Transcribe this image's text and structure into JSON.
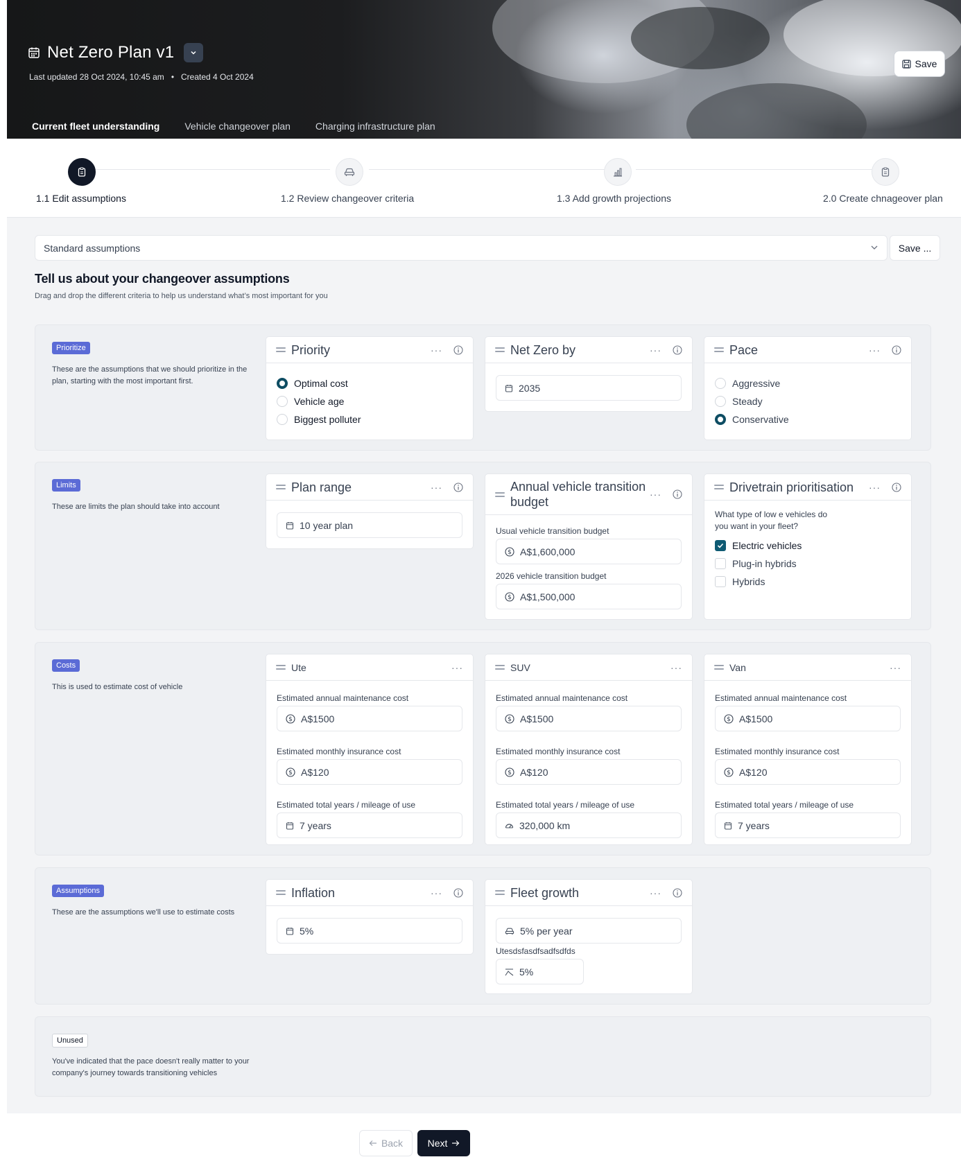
{
  "header": {
    "title": "Net Zero Plan v1",
    "last_updated": "Last updated 28 Oct 2024, 10:45 am",
    "separator": "•",
    "created": "Created 4 Oct 2024",
    "save_label": "Save"
  },
  "tabs": [
    {
      "label": "Current fleet understanding",
      "active": true
    },
    {
      "label": "Vehicle changeover plan",
      "active": false
    },
    {
      "label": "Charging infrastructure plan",
      "active": false
    }
  ],
  "steps": [
    {
      "label": "1.1 Edit assumptions",
      "icon": "clipboard-icon",
      "active": true
    },
    {
      "label": "1.2 Review changeover criteria",
      "icon": "car-icon",
      "active": false
    },
    {
      "label": "1.3 Add growth projections",
      "icon": "bar-chart-icon",
      "active": false
    },
    {
      "label": "2.0 Create chnageover plan",
      "icon": "clipboard-icon",
      "active": false
    }
  ],
  "assumption_set": {
    "selected": "Standard assumptions",
    "save_label": "Save ..."
  },
  "intro": {
    "title": "Tell us about your changeover assumptions",
    "subtitle": "Drag and drop the different criteria to help us understand what’s most important for you"
  },
  "groups": {
    "prioritize": {
      "badge": "Prioritize",
      "description": "These are the assumptions that we should prioritize in the plan, starting with the most important first.",
      "priority": {
        "title": "Priority",
        "options": [
          "Optimal cost",
          "Vehicle age",
          "Biggest polluter"
        ],
        "selected": "Optimal cost"
      },
      "net_zero": {
        "title": "Net Zero by",
        "value": "2035"
      },
      "pace": {
        "title": "Pace",
        "options": [
          "Aggressive",
          "Steady",
          "Conservative"
        ],
        "selected": "Conservative"
      }
    },
    "limits": {
      "badge": "Limits",
      "description": "These are limits the plan should take into account",
      "plan_range": {
        "title": "Plan range",
        "value": "10 year plan"
      },
      "budget": {
        "title": "Annual vehicle transition budget",
        "usual_label": "Usual vehicle transition budget",
        "usual_value": "A$1,600,000",
        "y2026_label": "2026 vehicle transition budget",
        "y2026_value": "A$1,500,000"
      },
      "drivetrain": {
        "title": "Drivetrain prioritisation",
        "question": "What type of low e vehicles do you want in your fleet?",
        "options": [
          {
            "label": "Electric vehicles",
            "checked": true
          },
          {
            "label": "Plug-in hybrids",
            "checked": false
          },
          {
            "label": "Hybrids",
            "checked": false
          }
        ]
      }
    },
    "costs": {
      "badge": "Costs",
      "description": "This is used to estimate cost of vehicle",
      "maintenance_label": "Estimated annual maintenance cost",
      "insurance_label": "Estimated monthly insurance cost",
      "usage_label": "Estimated total years / mileage of use",
      "vehicles": [
        {
          "title": "Ute",
          "maintenance": "A$1500",
          "insurance": "A$120",
          "usage": "7 years",
          "usage_icon": "calendar-icon"
        },
        {
          "title": "SUV",
          "maintenance": "A$1500",
          "insurance": "A$120",
          "usage": "320,000 km",
          "usage_icon": "gauge-icon"
        },
        {
          "title": "Van",
          "maintenance": "A$1500",
          "insurance": "A$120",
          "usage": "7 years",
          "usage_icon": "calendar-icon"
        }
      ]
    },
    "assumptions": {
      "badge": "Assumptions",
      "description": "These are the assumptions we'll use to estimate costs",
      "inflation": {
        "title": "Inflation",
        "value": "5%"
      },
      "fleet_growth": {
        "title": "Fleet growth",
        "value": "5% per year",
        "sub_label": "Utesdsfasdfsadfsdfds",
        "sub_value": "5%"
      }
    },
    "unused": {
      "badge": "Unused",
      "description": "You've indicated that the pace doesn't really matter to your company's journey towards transitioning vehicles"
    }
  },
  "footer": {
    "back_label": "Back",
    "next_label": "Next"
  },
  "colors": {
    "primary": "#111827",
    "badge": "#5b6bd6",
    "radio_checked": "#0e4d63",
    "page_bg": "#f3f4f6"
  }
}
